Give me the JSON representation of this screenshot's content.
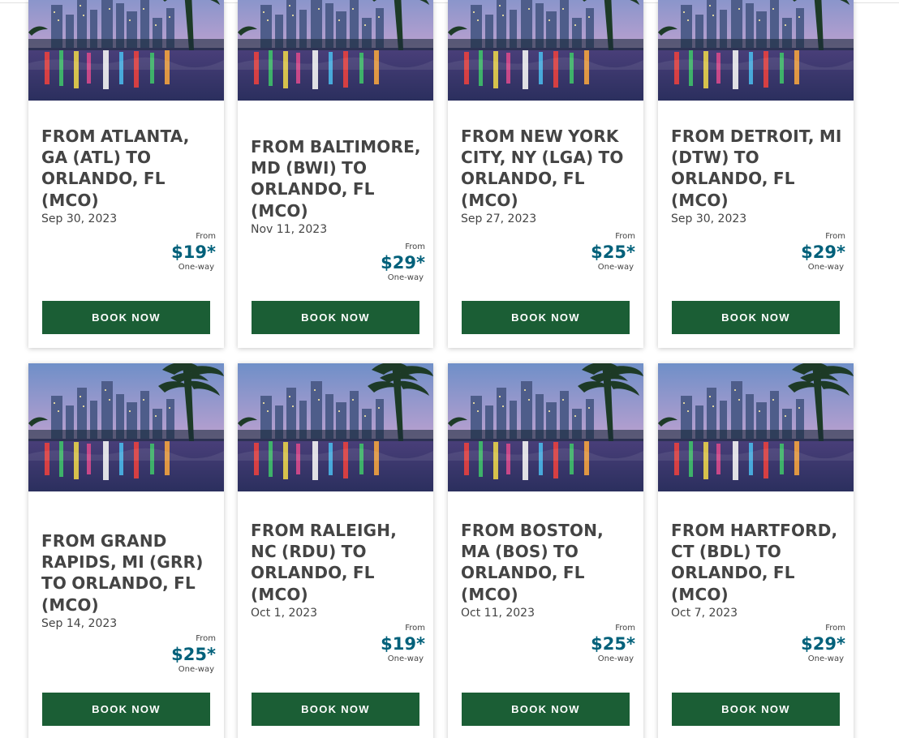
{
  "deals": [
    {
      "title": "FROM ATLANTA, GA (ATL) TO ORLANDO, FL (MCO)",
      "date": "Sep 30, 2023",
      "from_label": "From",
      "price": "$19*",
      "trip_type": "One-way",
      "button": "BOOK NOW"
    },
    {
      "title": "FROM BALTIMORE, MD (BWI) TO ORLANDO, FL (MCO)",
      "date": "Nov 11, 2023",
      "from_label": "From",
      "price": "$29*",
      "trip_type": "One-way",
      "button": "BOOK NOW"
    },
    {
      "title": "FROM NEW YORK CITY, NY (LGA) TO ORLANDO, FL (MCO)",
      "date": "Sep 27, 2023",
      "from_label": "From",
      "price": "$25*",
      "trip_type": "One-way",
      "button": "BOOK NOW"
    },
    {
      "title": "FROM DETROIT, MI (DTW) TO ORLANDO, FL (MCO)",
      "date": "Sep 30, 2023",
      "from_label": "From",
      "price": "$29*",
      "trip_type": "One-way",
      "button": "BOOK NOW"
    },
    {
      "title": "FROM GRAND RAPIDS, MI (GRR) TO ORLANDO, FL (MCO)",
      "date": "Sep 14, 2023",
      "from_label": "From",
      "price": "$25*",
      "trip_type": "One-way",
      "button": "BOOK NOW"
    },
    {
      "title": "FROM RALEIGH, NC (RDU) TO ORLANDO, FL (MCO)",
      "date": "Oct 1, 2023",
      "from_label": "From",
      "price": "$19*",
      "trip_type": "One-way",
      "button": "BOOK NOW"
    },
    {
      "title": "FROM BOSTON, MA (BOS) TO ORLANDO, FL (MCO)",
      "date": "Oct 11, 2023",
      "from_label": "From",
      "price": "$25*",
      "trip_type": "One-way",
      "button": "BOOK NOW"
    },
    {
      "title": "FROM HARTFORD, CT (BDL) TO ORLANDO, FL (MCO)",
      "date": "Oct 7, 2023",
      "from_label": "From",
      "price": "$29*",
      "trip_type": "One-way",
      "button": "BOOK NOW"
    }
  ],
  "colors": {
    "button": "#1b5e35",
    "price": "#00607a",
    "text": "#444444"
  },
  "image_icon": "orlando-skyline-photo"
}
